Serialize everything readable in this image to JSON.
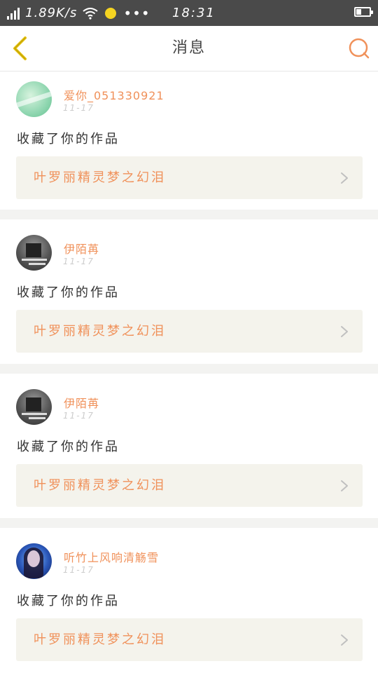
{
  "status_bar": {
    "net_speed": "1.89K/s",
    "more": "•••",
    "time": "18:31"
  },
  "header": {
    "title": "消息"
  },
  "messages": [
    {
      "username": "爱你_051330921",
      "date": "11-17",
      "action": "收藏了你的作品",
      "work_title": "叶罗丽精灵梦之幻泪"
    },
    {
      "username": "伊陌苒",
      "date": "11-17",
      "action": "收藏了你的作品",
      "work_title": "叶罗丽精灵梦之幻泪"
    },
    {
      "username": "伊陌苒",
      "date": "11-17",
      "action": "收藏了你的作品",
      "work_title": "叶罗丽精灵梦之幻泪"
    },
    {
      "username": "听竹上风响清觞雪",
      "date": "11-17",
      "action": "收藏了你的作品",
      "work_title": "叶罗丽精灵梦之幻泪"
    }
  ],
  "colors": {
    "accent": "#f0915a",
    "header_icon": "#e6c20e",
    "status_bar_bg": "#4a4a4a",
    "card_bg": "#f4f3ec"
  }
}
